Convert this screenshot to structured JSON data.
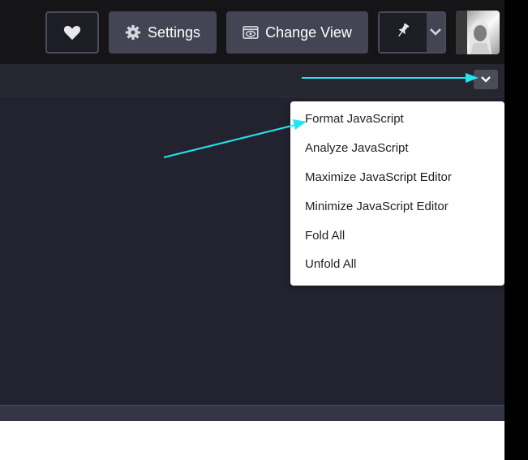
{
  "header": {
    "settings_label": "Settings",
    "change_view_label": "Change View"
  },
  "icons": {
    "heart": "heart-icon",
    "settings": "gear-icon",
    "change_view": "eye-window-icon",
    "pin": "pin-icon",
    "caret": "chevron-down-icon",
    "collapse": "chevron-down-icon"
  },
  "menu": {
    "items": [
      {
        "label": "Format JavaScript"
      },
      {
        "label": "Analyze JavaScript"
      },
      {
        "label": "Maximize JavaScript Editor"
      },
      {
        "label": "Minimize JavaScript Editor"
      },
      {
        "label": "Fold All"
      },
      {
        "label": "Unfold All"
      }
    ]
  },
  "colors": {
    "annotation_arrow": "#22e5f0",
    "topbar_bg": "#151518",
    "button_bg": "#434554",
    "editor_bg": "#232330"
  }
}
